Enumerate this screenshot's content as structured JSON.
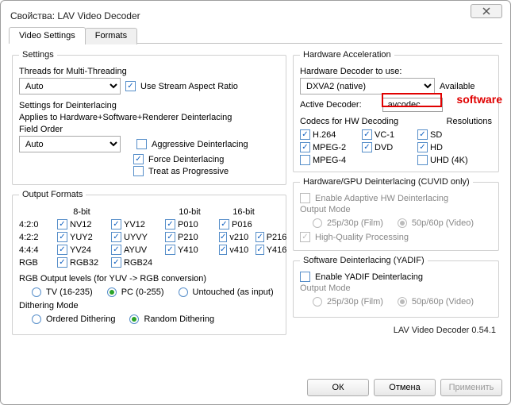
{
  "window": {
    "title": "Свойства: LAV Video Decoder"
  },
  "tabs": {
    "video_settings": "Video Settings",
    "formats": "Formats"
  },
  "settings_group": {
    "legend": "Settings",
    "threads_label": "Threads for Multi-Threading",
    "threads_value": "Auto",
    "use_sar": "Use Stream Aspect Ratio",
    "deint_label": "Settings for Deinterlacing",
    "deint_applies": "Applies to Hardware+Software+Renderer Deinterlacing",
    "field_order_label": "Field Order",
    "field_order_value": "Auto",
    "aggressive": "Aggressive Deinterlacing",
    "force": "Force Deinterlacing",
    "progressive": "Treat as Progressive"
  },
  "output_formats": {
    "legend": "Output Formats",
    "hdr_8": "8-bit",
    "hdr_10": "10-bit",
    "hdr_16": "16-bit",
    "rows": {
      "r420": "4:2:0",
      "r422": "4:2:2",
      "r444": "4:4:4",
      "rgb": "RGB"
    },
    "nv12": "NV12",
    "yv12": "YV12",
    "p010": "P010",
    "p016": "P016",
    "yuy2": "YUY2",
    "uyvy": "UYVY",
    "p210": "P210",
    "v210": "v210",
    "p216": "P216",
    "yv24": "YV24",
    "ayuv": "AYUV",
    "y410": "Y410",
    "v410": "v410",
    "y416": "Y416",
    "rgb32": "RGB32",
    "rgb24": "RGB24",
    "rgb_levels_label": "RGB Output levels (for YUV -> RGB conversion)",
    "rgb_tv": "TV (16-235)",
    "rgb_pc": "PC (0-255)",
    "rgb_untouched": "Untouched (as input)",
    "dither_label": "Dithering Mode",
    "dither_ordered": "Ordered Dithering",
    "dither_random": "Random Dithering"
  },
  "hw_accel": {
    "legend": "Hardware Acceleration",
    "decoder_to_use": "Hardware Decoder to use:",
    "decoder_value": "DXVA2 (native)",
    "available": "Available",
    "active_decoder_label": "Active Decoder:",
    "active_decoder_value": "avcodec",
    "annotation": "software",
    "codecs_label": "Codecs for HW Decoding",
    "resolutions_label": "Resolutions",
    "h264": "H.264",
    "vc1": "VC-1",
    "mpeg2": "MPEG-2",
    "dvd": "DVD",
    "mpeg4": "MPEG-4",
    "sd": "SD",
    "hd": "HD",
    "uhd": "UHD (4K)"
  },
  "hw_deint": {
    "legend": "Hardware/GPU Deinterlacing (CUVID only)",
    "enable": "Enable Adaptive HW Deinterlacing",
    "mode_label": "Output Mode",
    "film": "25p/30p (Film)",
    "video": "50p/60p (Video)",
    "hq": "High-Quality Processing"
  },
  "sw_deint": {
    "legend": "Software Deinterlacing (YADIF)",
    "enable": "Enable YADIF Deinterlacing",
    "mode_label": "Output Mode",
    "film": "25p/30p (Film)",
    "video": "50p/60p (Video)"
  },
  "version": "LAV Video Decoder 0.54.1",
  "buttons": {
    "ok": "ОК",
    "cancel": "Отмена",
    "apply": "Применить"
  }
}
